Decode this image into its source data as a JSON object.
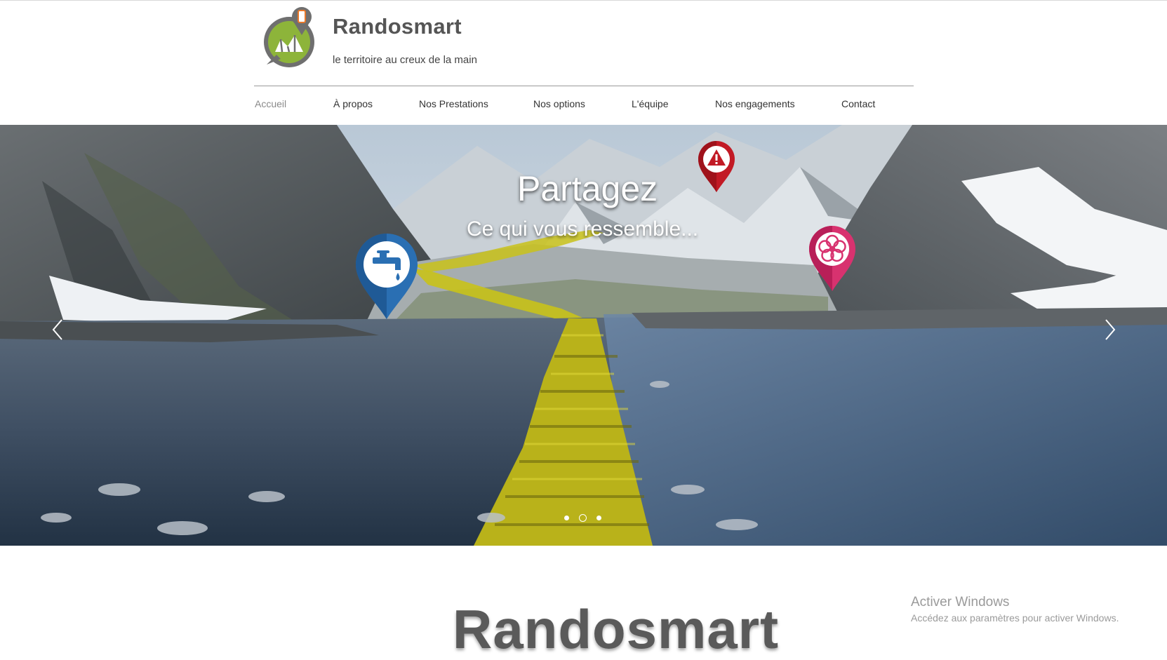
{
  "header": {
    "brand_name": "Randosmart",
    "tagline": "le territoire au creux de la main"
  },
  "nav": {
    "items": [
      {
        "label": "Accueil",
        "active": true
      },
      {
        "label": "À propos",
        "active": false
      },
      {
        "label": "Nos Prestations",
        "active": false
      },
      {
        "label": "Nos options",
        "active": false
      },
      {
        "label": "L'équipe",
        "active": false
      },
      {
        "label": "Nos engagements",
        "active": false
      },
      {
        "label": "Contact",
        "active": false
      }
    ]
  },
  "hero": {
    "title": "Partagez",
    "subtitle": "Ce qui vous ressemble...",
    "slides_count": 3,
    "active_slide": 2,
    "pins": [
      "water-tap-icon",
      "warning-icon",
      "flower-icon"
    ],
    "prev_icon": "chevron-left-icon",
    "next_icon": "chevron-right-icon"
  },
  "main": {
    "heading": "Randosmart"
  },
  "watermark": {
    "title": "Activer Windows",
    "subtitle": "Accédez aux paramètres pour activer Windows."
  },
  "colors": {
    "logo_green": "#8db43a",
    "logo_grey": "#6f6f6f",
    "logo_orange": "#e8782a",
    "pin_blue": "#2a6fb3",
    "pin_red": "#c21a25",
    "pin_pink": "#d8326f",
    "path_yellow": "#c9c21a"
  }
}
